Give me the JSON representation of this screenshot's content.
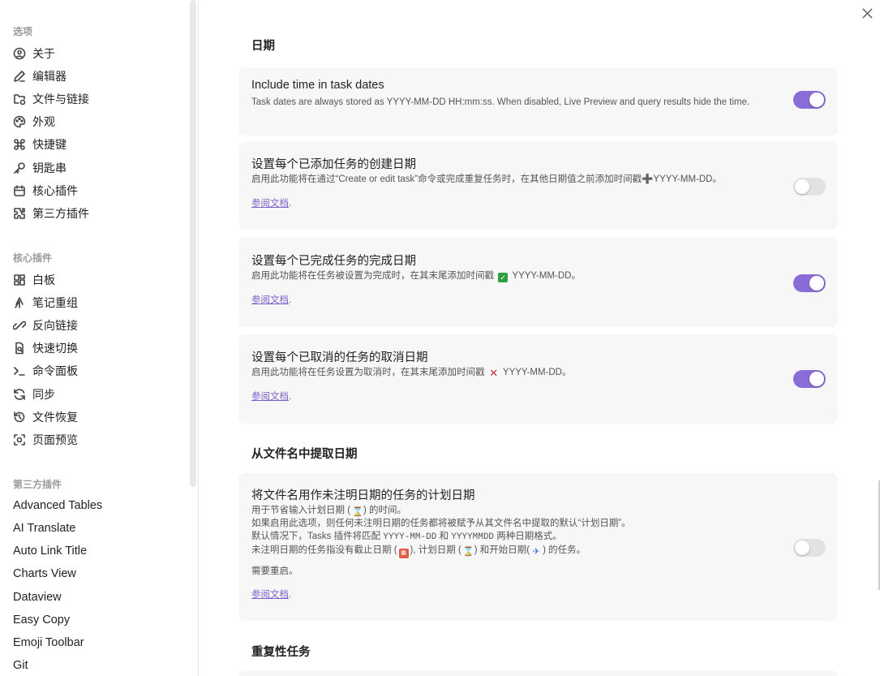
{
  "sidebar": {
    "options_title": "选项",
    "options": [
      {
        "label": "关于",
        "icon": "about-icon"
      },
      {
        "label": "编辑器",
        "icon": "pencil-icon"
      },
      {
        "label": "文件与链接",
        "icon": "folder-link-icon"
      },
      {
        "label": "外观",
        "icon": "palette-icon"
      },
      {
        "label": "快捷键",
        "icon": "command-icon"
      },
      {
        "label": "钥匙串",
        "icon": "key-icon"
      },
      {
        "label": "核心插件",
        "icon": "calendar-plugin-icon"
      },
      {
        "label": "第三方插件",
        "icon": "puzzle-icon"
      }
    ],
    "core_title": "核心插件",
    "core": [
      {
        "label": "白板",
        "icon": "grid-icon"
      },
      {
        "label": "笔记重组",
        "icon": "merge-icon"
      },
      {
        "label": "反向链接",
        "icon": "backlink-icon"
      },
      {
        "label": "快速切换",
        "icon": "file-search-icon"
      },
      {
        "label": "命令面板",
        "icon": "terminal-icon"
      },
      {
        "label": "同步",
        "icon": "sync-icon"
      },
      {
        "label": "文件恢复",
        "icon": "history-icon"
      },
      {
        "label": "页面预览",
        "icon": "preview-icon"
      }
    ],
    "third_title": "第三方插件",
    "third": [
      "Advanced Tables",
      "AI Translate",
      "Auto Link Title",
      "Charts View",
      "Dataview",
      "Easy Copy",
      "Emoji Toolbar",
      "Git"
    ]
  },
  "main": {
    "section_dates": "日期",
    "section_filename": "从文件名中提取日期",
    "section_recurring": "重复性任务",
    "link_label": "参阅文档",
    "link_suffix": ".",
    "cards": {
      "include_time": {
        "title": "Include time in task dates",
        "desc": "Task dates are always stored as YYYY-MM-DD HH:mm:ss. When disabled, Live Preview and query results hide the time.",
        "toggle": true
      },
      "created": {
        "title": "设置每个已添加任务的创建日期",
        "desc": "启用此功能将在通过“Create or edit task”命令或完成重复任务时，在其他日期值之前添加时间戳➕YYYY-MM-DD。",
        "toggle": false
      },
      "done": {
        "title": "设置每个已完成任务的完成日期",
        "desc_pre": "启用此功能将在任务被设置为完成时，在其末尾添加时间戳",
        "desc_post": "YYYY-MM-DD。",
        "toggle": true
      },
      "cancelled": {
        "title": "设置每个已取消的任务的取消日期",
        "desc_pre": "启用此功能将在任务设置为取消时，在其末尾添加时间戳",
        "desc_post": "YYYY-MM-DD。",
        "toggle": true
      },
      "filename": {
        "title": "将文件名用作未注明日期的任务的计划日期",
        "line1_pre": "用于节省输入计划日期 (",
        "line1_post": ") 的时间。",
        "line2": "如果启用此选项，则任何未注明日期的任务都将被赋予从其文件名中提取的默认“计划日期”。",
        "line3_pre": "默认情况下，Tasks 插件将匹配",
        "line3_code1": "YYYY-MM-DD",
        "line3_mid": "和",
        "line3_code2": "YYYYMMDD",
        "line3_post": "两种日期格式。",
        "line4_a": "未注明日期的任务指没有截止日期 (",
        "line4_b": "), 计划日期 (",
        "line4_c": ") 和开始日期(",
        "line4_d": ") 的任务。",
        "restart": "需要重启。",
        "toggle": false
      }
    }
  },
  "colors": {
    "accent": "#8a6cd8",
    "link": "#7b5fc7"
  }
}
